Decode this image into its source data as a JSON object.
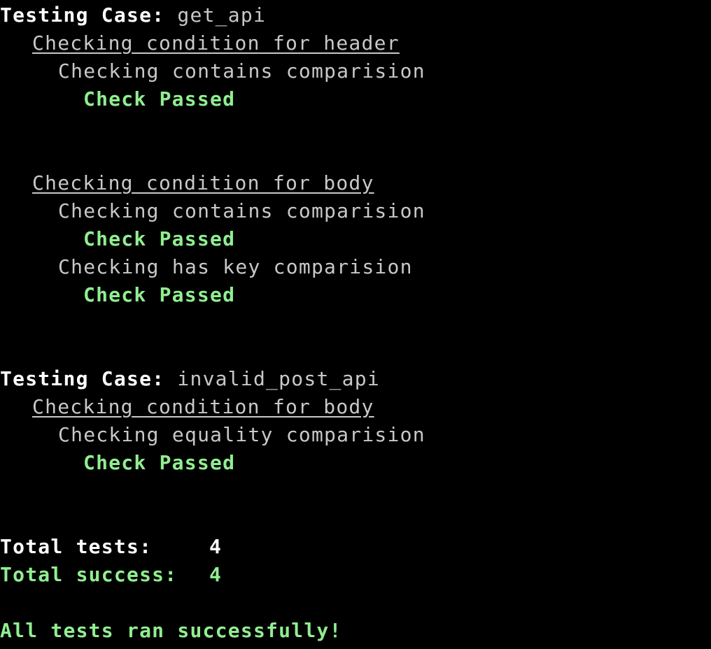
{
  "colors": {
    "background": "#000000",
    "heading": "#ffffff",
    "text": "#c8c8c8",
    "success": "#90ee90"
  },
  "cases": [
    {
      "label": "Testing Case: ",
      "name": "get_api",
      "conditions": [
        {
          "title": "Checking condition for header",
          "checks": [
            {
              "text": "Checking contains comparision",
              "result": "Check Passed"
            }
          ]
        },
        {
          "title": "Checking condition for body",
          "checks": [
            {
              "text": "Checking contains comparision",
              "result": "Check Passed"
            },
            {
              "text": "Checking has key comparision",
              "result": "Check Passed"
            }
          ]
        }
      ]
    },
    {
      "label": "Testing Case: ",
      "name": "invalid_post_api",
      "conditions": [
        {
          "title": "Checking condition for body",
          "checks": [
            {
              "text": "Checking equality comparision",
              "result": "Check Passed"
            }
          ]
        }
      ]
    }
  ],
  "summary": {
    "total_tests_label": "Total tests:",
    "total_tests_value": "4",
    "total_success_label": "Total success:",
    "total_success_value": "4",
    "final_message": "All tests ran successfully!"
  }
}
